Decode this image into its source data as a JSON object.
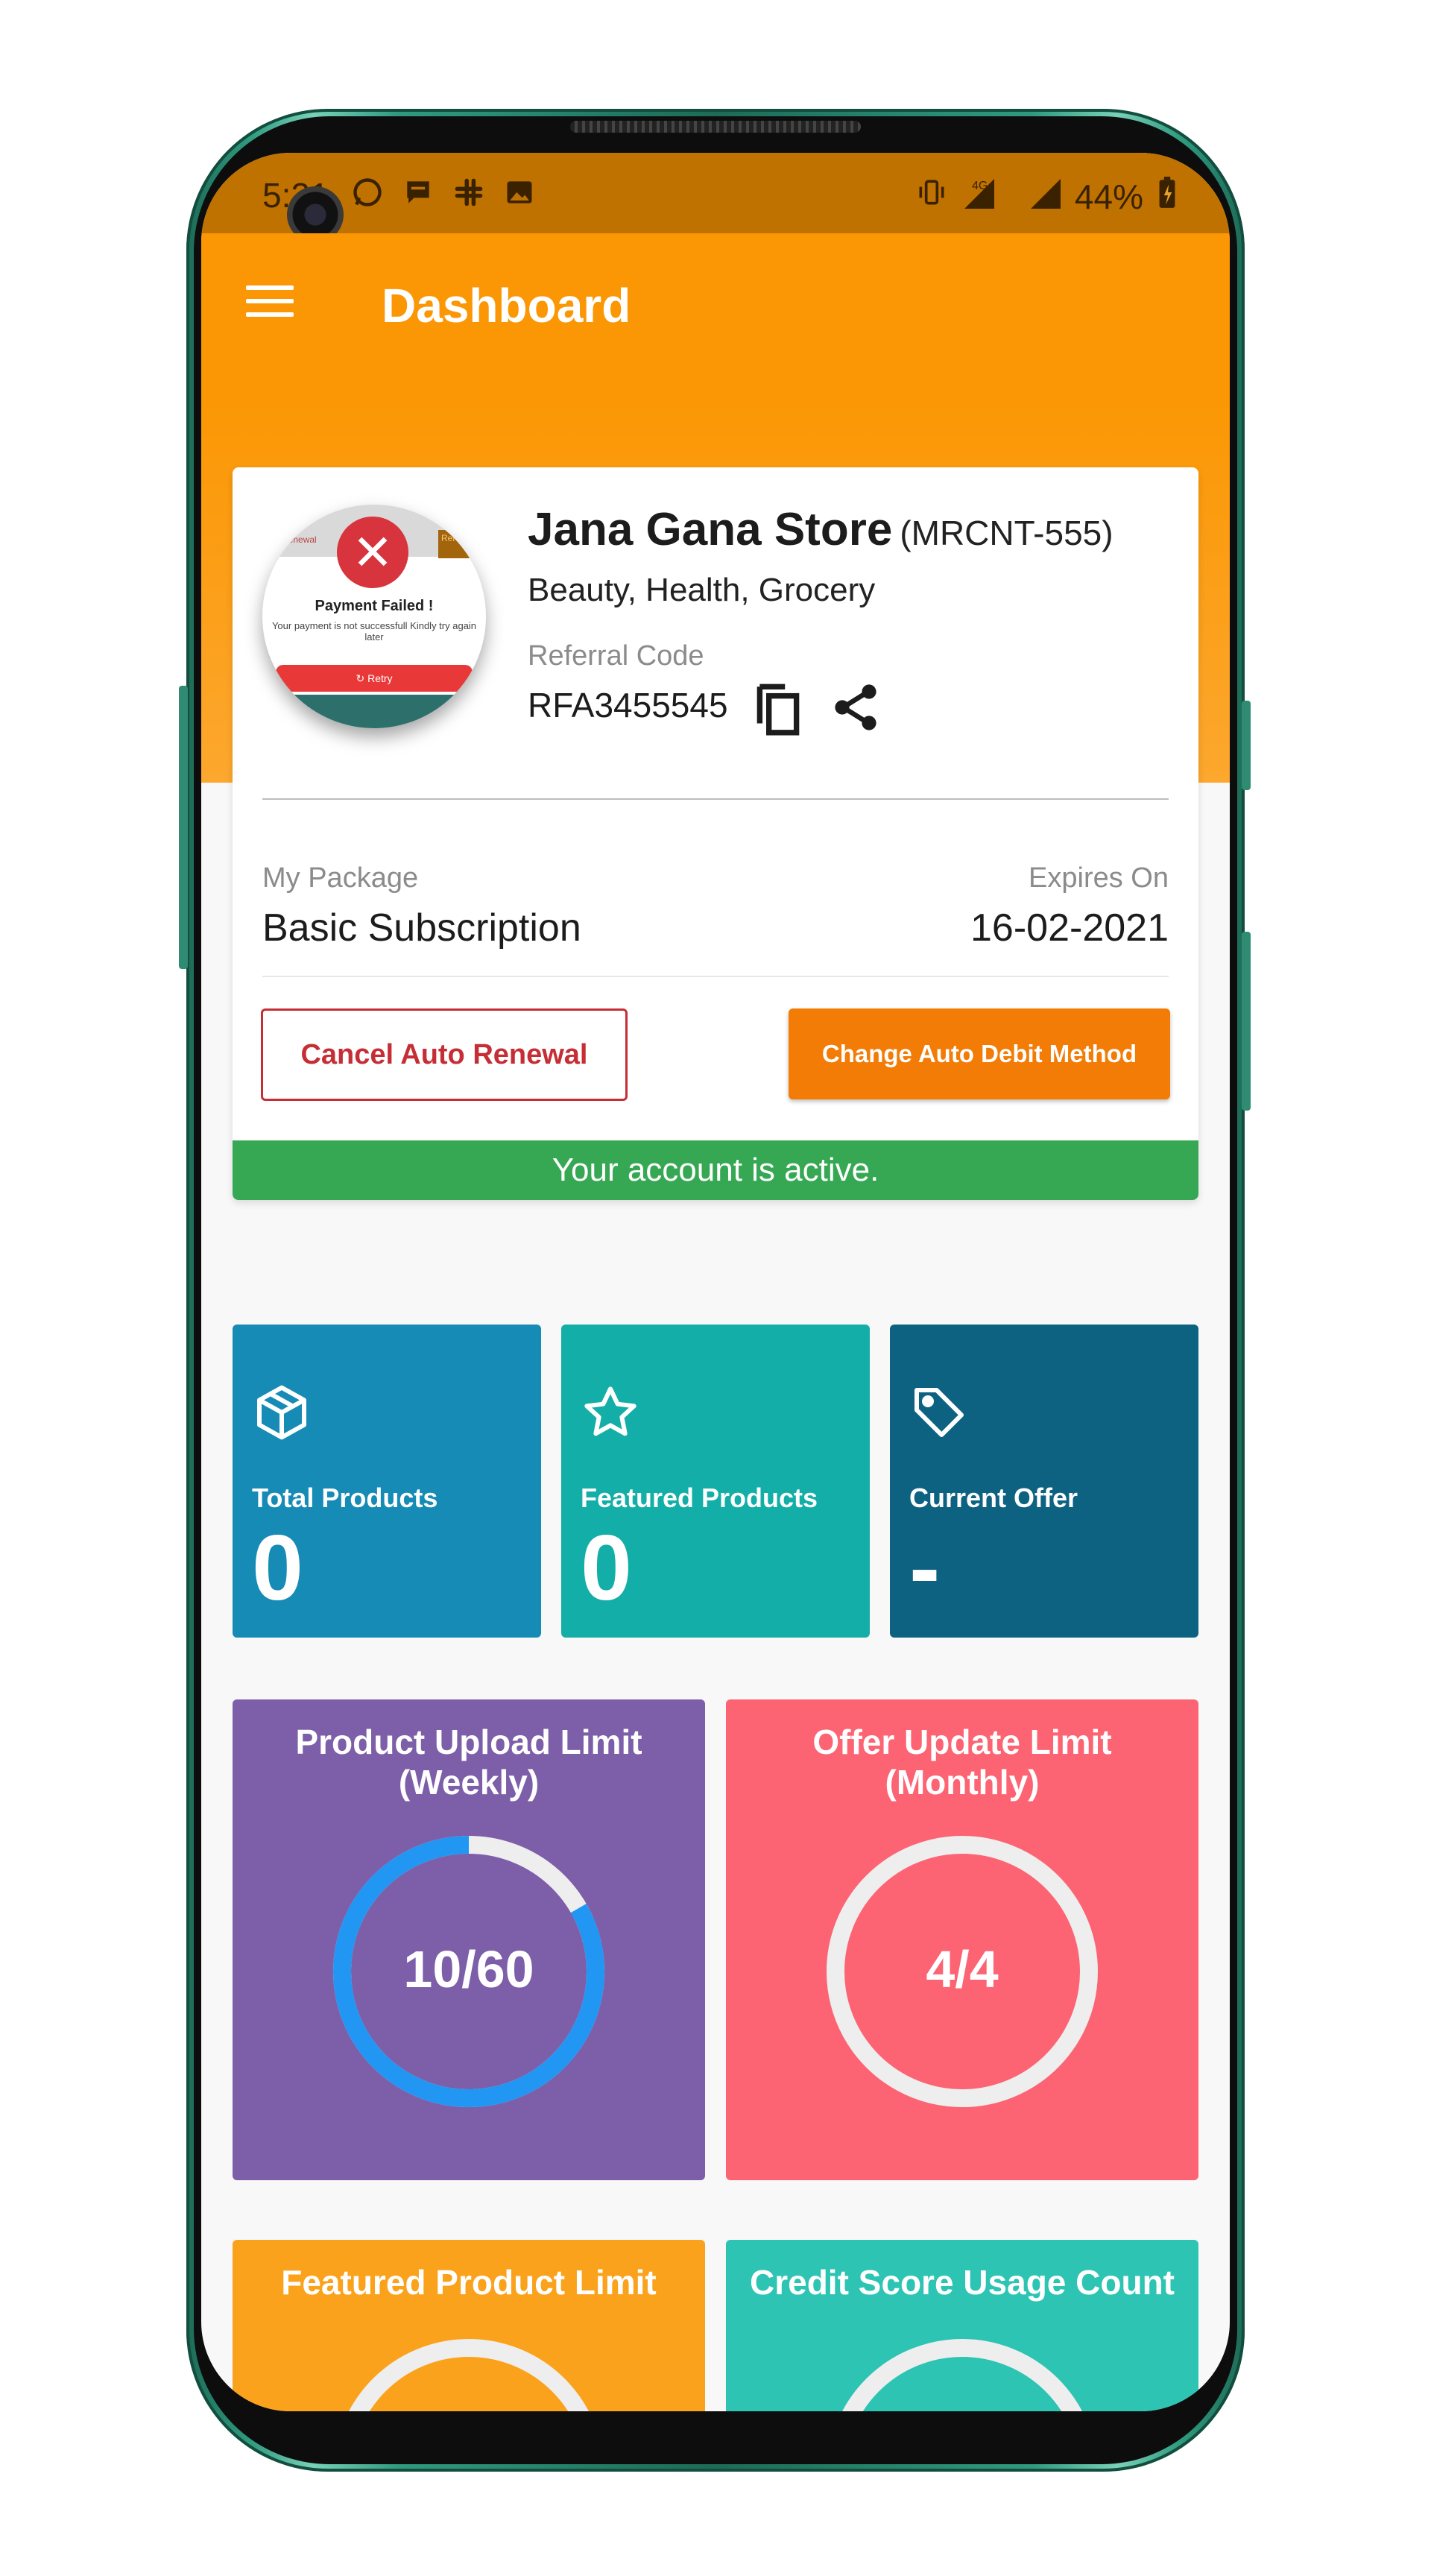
{
  "status_bar": {
    "time": "5:21",
    "battery": "44%",
    "network": "4G"
  },
  "app_bar": {
    "title": "Dashboard"
  },
  "profile": {
    "store_name": "Jana Gana Store",
    "store_code": "(MRCNT-555)",
    "categories": "Beauty, Health, Grocery",
    "referral_label": "Referral Code",
    "referral_code": "RFA3455545",
    "avatar_popup": {
      "title": "Payment Failed !",
      "message": "Your payment is not successfull Kindly try again later",
      "retry_label": "Retry",
      "top_left_text": "uto Renewal",
      "top_right_text": "Rene"
    }
  },
  "package": {
    "label": "My Package",
    "value": "Basic Subscription",
    "expires_label": "Expires On",
    "expires_value": "16-02-2021"
  },
  "actions": {
    "cancel_label": "Cancel Auto Renewal",
    "change_label": "Change Auto Debit Method"
  },
  "account_status": "Your account is active.",
  "tiles": [
    {
      "label": "Total Products",
      "value": "0",
      "icon": "box-icon",
      "color": "#168bb6"
    },
    {
      "label": "Featured Products",
      "value": "0",
      "icon": "star-icon",
      "color": "#12aea7"
    },
    {
      "label": "Current Offer",
      "value": "-",
      "icon": "tag-icon",
      "color": "#0e6281"
    }
  ],
  "limits": [
    {
      "title_line1": "Product Upload Limit",
      "title_line2": "(Weekly)",
      "value": "10/60",
      "used": 10,
      "total": 60,
      "color": "#7d5ea8",
      "ring_color": "#2196f3"
    },
    {
      "title_line1": "Offer Update Limit",
      "title_line2": "(Monthly)",
      "value": "4/4",
      "used": 4,
      "total": 4,
      "color": "#fc6473",
      "ring_color": "#eeeeee"
    },
    {
      "title_line1": "Featured Product Limit",
      "title_line2": "",
      "value": "",
      "color": "#fba21c",
      "ring_color": "#eeeeee"
    },
    {
      "title_line1": "Credit Score Usage Count",
      "title_line2": "",
      "value": "",
      "color": "#2dc4b4",
      "ring_color": "#eeeeee"
    }
  ],
  "colors": {
    "primary": "#fb9704",
    "status_bar": "#c07200",
    "danger": "#c62e35",
    "success": "#36a853",
    "accent_button": "#f27c06"
  }
}
